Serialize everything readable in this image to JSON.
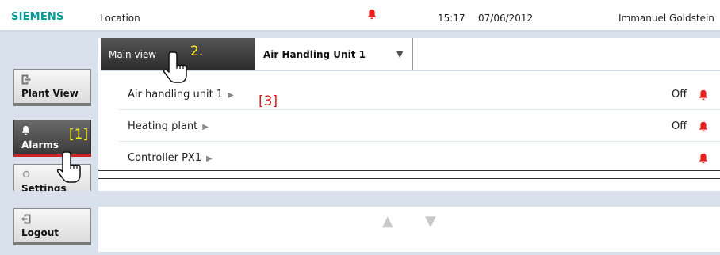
{
  "header": {
    "logo": "SIEMENS",
    "location_label": "Location",
    "time": "15:17",
    "date": "07/06/2012",
    "user": "Immanuel Goldstein",
    "alarm_color": "#e8201f"
  },
  "sidebar": {
    "items": [
      {
        "label": "Plant View",
        "icon": "plant-view-icon"
      },
      {
        "label": "Alarms",
        "icon": "bell-icon"
      },
      {
        "label": "Settings",
        "icon": "settings-icon"
      },
      {
        "label": "Logout",
        "icon": "logout-icon"
      }
    ]
  },
  "tabs": {
    "main_label": "Main view",
    "unit_label": "Air Handling Unit 1"
  },
  "list": {
    "rows": [
      {
        "name": "Air handling unit 1",
        "status": "Off",
        "alarm": true
      },
      {
        "name": "Heating plant",
        "status": "Off",
        "alarm": true
      },
      {
        "name": "Controller PX1",
        "status": "",
        "alarm": true
      }
    ]
  },
  "annotations": {
    "step2": "2.",
    "step1": "[1]",
    "step3": "[3]"
  },
  "colors": {
    "brand": "#009999",
    "alarm": "#e8201f",
    "panel_bg": "#d9e2ec",
    "annotation_yellow": "#ffee22",
    "annotation_red": "#d61a1a"
  }
}
